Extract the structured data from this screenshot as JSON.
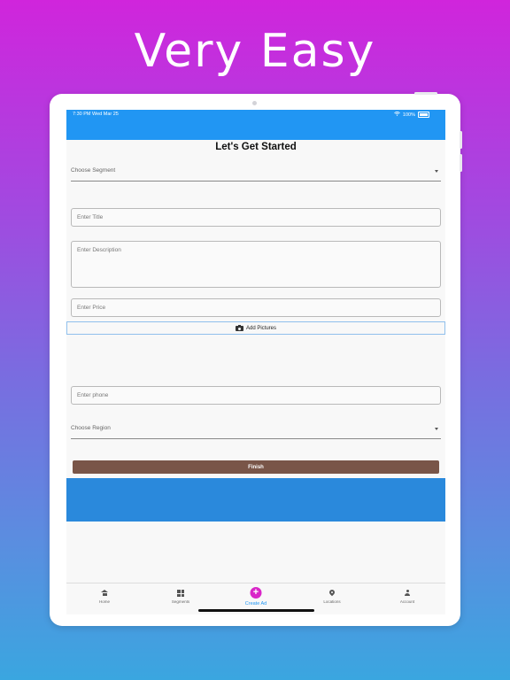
{
  "headline": "Very Easy",
  "status_bar": {
    "time_date": "7:30 PM   Wed Mar 25",
    "battery": "100%"
  },
  "form": {
    "title": "Let's Get Started",
    "segment_dropdown": "Choose Segment",
    "title_placeholder": "Enter Title",
    "description_placeholder": "Enter Description",
    "price_placeholder": "Enter Price",
    "add_pictures_label": "Add Pictures",
    "phone_placeholder": "Enter phone",
    "region_dropdown": "Choose Region",
    "finish_label": "Finish"
  },
  "bottom_nav": {
    "items": [
      {
        "label": "Home",
        "icon": "home-icon"
      },
      {
        "label": "Segments",
        "icon": "dashboard-icon"
      },
      {
        "label": "Create Ad",
        "icon": "plus-circle-icon",
        "active": true
      },
      {
        "label": "Locations",
        "icon": "location-pin-icon"
      },
      {
        "label": "Account",
        "icon": "person-icon"
      }
    ]
  },
  "colors": {
    "app_bar": "#2196f3",
    "finish_button": "#795548",
    "banner": "#2a89dc",
    "create_ad_accent": "#d926c8",
    "active_nav_label": "#2196f3"
  }
}
